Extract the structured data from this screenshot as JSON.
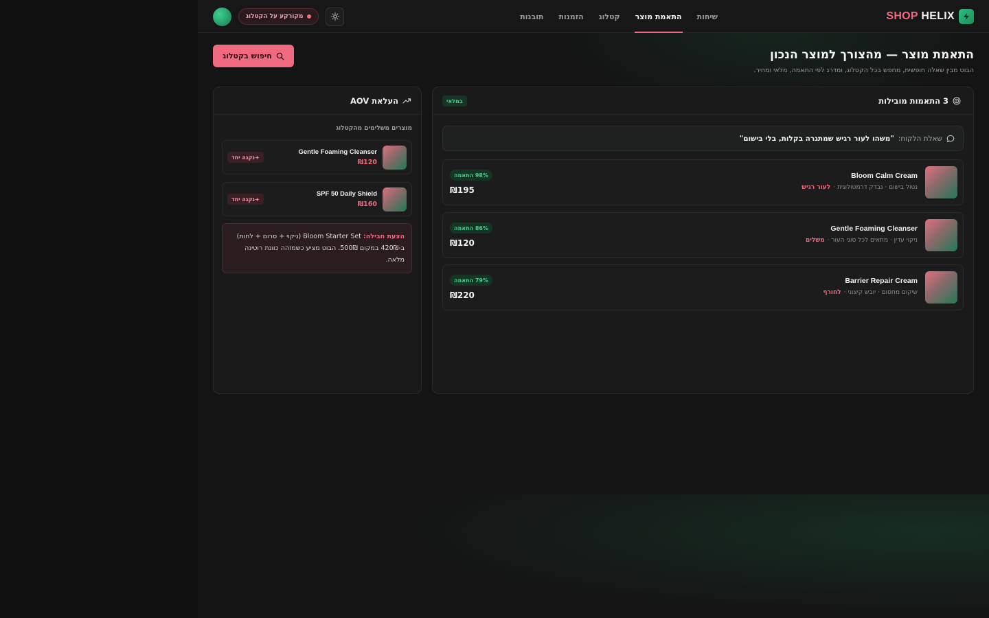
{
  "header": {
    "brand_shop": "SHOP",
    "brand_helix": "HELIX",
    "nav": [
      {
        "label": "שיחות",
        "active": false
      },
      {
        "label": "התאמת מוצר",
        "active": true
      },
      {
        "label": "קטלוג",
        "active": false
      },
      {
        "label": "הזמנות",
        "active": false
      },
      {
        "label": "תובנות",
        "active": false
      }
    ],
    "catalog_pill": "מקורקע על הקטלוג"
  },
  "page": {
    "title": "התאמת מוצר — מהצורך למוצר הנכון",
    "subtitle": "הבוט מבין שאלה חופשית, מחפש בכל הקטלוג, ומדרג לפי התאמה, מלאי ומחיר.",
    "search_button": "חיפוש בקטלוג"
  },
  "matches": {
    "title": "3 התאמות מובילות",
    "badge": "במלאי",
    "query_label": "שאלת הלקוח:",
    "query_text": "\"משהו לעור רגיש שמתגרה בקלות, בלי בישום\"",
    "products": [
      {
        "name": "Bloom Calm Cream",
        "meta": "נטול בישום · נבדק דרמטולוגית ·",
        "tag": "לעור רגיש",
        "match": "98% התאמה",
        "price": "₪195"
      },
      {
        "name": "Gentle Foaming Cleanser",
        "meta": "ניקוי עדין · מתאים לכל סוגי העור ·",
        "tag": "משלים",
        "match": "86% התאמה",
        "price": "₪120"
      },
      {
        "name": "Barrier Repair Cream",
        "meta": "שיקום מחסום · יובש קיצוני ·",
        "tag": "לחורף",
        "match": "79% התאמה",
        "price": "₪220"
      }
    ]
  },
  "aov": {
    "title": "העלאת AOV",
    "section_label": "מוצרים משלימים מהקטלוג",
    "items": [
      {
        "name": "Gentle Foaming Cleanser",
        "price": "₪120",
        "button": "+נקנה יחד"
      },
      {
        "name": "SPF 50 Daily Shield",
        "price": "₪160",
        "button": "+נקנה יחד"
      }
    ],
    "bundle_label": "הצעת חבילה:",
    "bundle_text": "Bloom Starter Set (ניקוי + סרום + לחות) ב-420₪ במקום 500₪. הבוט מציע כשמזהה כוונת רוטינה מלאה."
  },
  "icons": {
    "brand": "bolt-icon",
    "theme": "sun-icon",
    "search": "search-icon",
    "matches": "target-icon",
    "query": "chat-bubble-icon",
    "aov": "trending-up-icon"
  },
  "colors": {
    "accent": "#f06a7f",
    "success": "#3fd08c",
    "background": "#141414"
  }
}
